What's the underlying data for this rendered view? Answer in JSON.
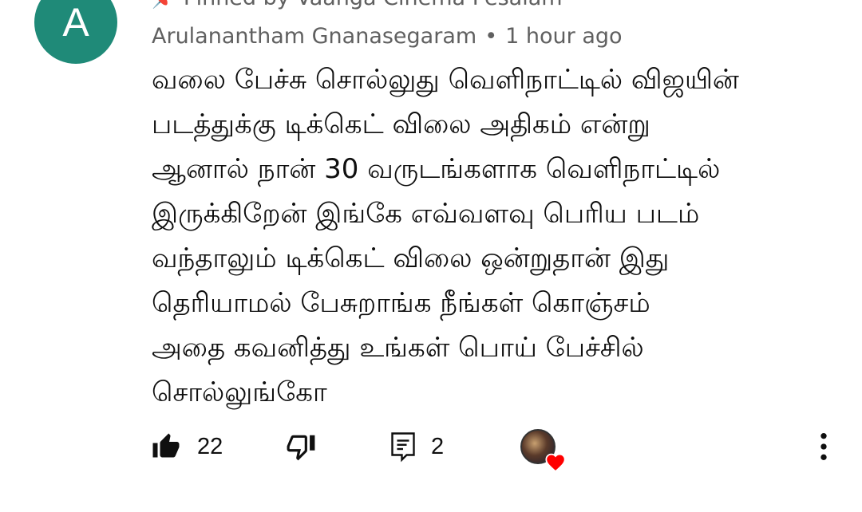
{
  "comment": {
    "avatar_letter": "A",
    "avatar_color": "#1f8a78",
    "pinned_text": "Pinned by Vaanga Cinema Pesalam",
    "author": "Arulanantham Gnanasegaram",
    "separator": "•",
    "timestamp": "1 hour ago",
    "body_lines": [
      "வலை பேச்சு சொல்லுது வெளிநாட்டில் விஜயின்",
      "படத்துக்கு டிக்கெட் விலை அதிகம் என்று",
      "ஆனால் நான் 30 வருடங்களாக வெளிநாட்டில்",
      "இருக்கிறேன் இங்கே எவ்வளவு பெரிய படம்",
      "வந்தாலும் டிக்கெட் விலை ஒன்றுதான் இது",
      "தெரியாமல் பேசுறாங்க நீங்கள் கொஞ்சம்",
      "அதை கவனித்து உங்கள் பொய் பேச்சில்",
      "சொல்லுங்கோ"
    ]
  },
  "actions": {
    "like_count": "22",
    "reply_count": "2",
    "icons": {
      "like": "thumbs-up-filled-icon",
      "dislike": "thumbs-down-outline-icon",
      "reply": "comment-reply-icon",
      "creator_heart": "creator-heart-icon",
      "more": "more-vertical-icon"
    },
    "heart_color": "#ff0000"
  }
}
